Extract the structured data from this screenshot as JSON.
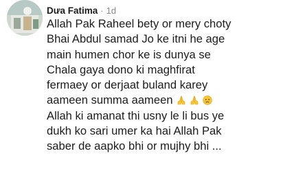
{
  "comment": {
    "author": "Dưa Fatima",
    "separator": "·",
    "time": "1d",
    "lines": [
      "Allah Pak Raheel bety or mery choty",
      "Bhai Abdul samad Jo ke itni he age",
      "main humen chor ke is dunya se",
      "Chala gaya dono ki maghfirat",
      "fermaey or derjaat buland karey",
      "aameen summa aameen",
      "Allah ki amanat thi usny le li bus ye",
      "dukh ko sari umer ka hai Allah Pak",
      "saber de aapko bhi or mujhy bhi ..."
    ],
    "emojis": [
      "praying-hands-icon",
      "praying-hands-icon",
      "sad-face-icon"
    ],
    "accent_yellow": "#f7c531"
  }
}
